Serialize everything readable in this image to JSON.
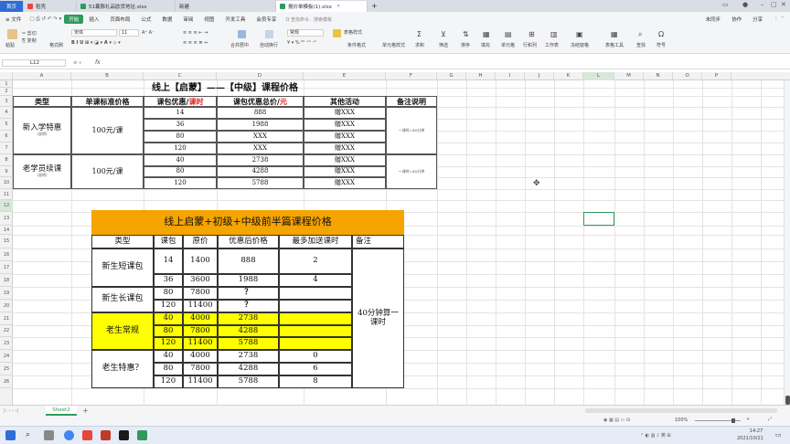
{
  "tabs": [
    {
      "label": "首页",
      "type": "home"
    },
    {
      "label": "稻壳",
      "icon_color": "#e8453c"
    },
    {
      "label": "51囊豚礼品欧货地址.xlsx",
      "icon_color": "#2f9a5a"
    },
    {
      "label": "新建",
      "icon_color": ""
    },
    {
      "label": "报价单模板(1).xlsx",
      "icon_color": "#2f9a5a",
      "active": true
    }
  ],
  "menu": {
    "file": "≡ 文件",
    "items": [
      "开始",
      "插入",
      "页面布局",
      "公式",
      "数据",
      "审阅",
      "视图",
      "开发工具",
      "会员专享"
    ],
    "search": "Q 查找命令、搜索模板",
    "right": [
      "未同步",
      "协作",
      "分享"
    ]
  },
  "ribbon": {
    "paste": "粘贴",
    "cut": "✂ 剪切",
    "copy": "⎘ 复制",
    "format_painter": "格式刷",
    "font": "宋体",
    "font_size": "11",
    "merge": "合并居中",
    "wrap": "自动换行",
    "number_format": "常规",
    "table_style": "表格样式",
    "cell_style": "单元格样式",
    "sum": "求和",
    "filter": "筛选",
    "sort": "排序",
    "fill": "填充",
    "cell": "单元格",
    "rowcol": "行和列",
    "sheet": "工作表",
    "freeze": "冻结窗格",
    "tools": "表格工具",
    "find": "查找",
    "symbol": "符号",
    "cond_format": "条件格式"
  },
  "formula_bar": {
    "cell_ref": "L12",
    "fx": "fx",
    "value": ""
  },
  "columns": [
    "A",
    "B",
    "C",
    "D",
    "E",
    "F",
    "G",
    "H",
    "I",
    "J",
    "K",
    "L",
    "M",
    "N",
    "O",
    "P"
  ],
  "rows": [
    "1",
    "2",
    "3",
    "4",
    "5",
    "6",
    "7",
    "8",
    "9",
    "10",
    "11",
    "12",
    "13",
    "14",
    "15",
    "16",
    "17",
    "18",
    "19",
    "20",
    "21",
    "22",
    "23",
    "24",
    "25",
    "26"
  ],
  "table1": {
    "title": "线上【启蒙】——【中级】课程价格",
    "headers": {
      "type": "类型",
      "unit_price": "单课标准价格",
      "pkg_prefix": "课包优惠/",
      "pkg_red": "课时",
      "total_prefix": "课包优惠总价/",
      "total_red": "元",
      "activity": "其他活动",
      "remark": "备注说明"
    },
    "groups": [
      {
        "name": "新入学特惠",
        "sub": "（说明）",
        "price": "100元/课",
        "remark": "一课时=40分钟",
        "rows": [
          [
            "14",
            "888",
            "赠XXX"
          ],
          [
            "36",
            "1988",
            "赠XXX"
          ],
          [
            "80",
            "XXX",
            "赠XXX"
          ],
          [
            "120",
            "XXX",
            "赠XXX"
          ]
        ]
      },
      {
        "name": "老学员续课",
        "sub": "（说明）",
        "price": "100元/课",
        "remark": "一课时=40分钟",
        "rows": [
          [
            "40",
            "2738",
            "赠XXX"
          ],
          [
            "80",
            "4288",
            "赠XXX"
          ],
          [
            "120",
            "5788",
            "赠XXX"
          ]
        ]
      }
    ]
  },
  "table2": {
    "title": "线上启蒙+初级+中级前半篇课程价格",
    "headers": [
      "类型",
      "课包",
      "原价",
      "优惠后价格",
      "最多加送课时",
      "备注"
    ],
    "remark": "40分钟算一课时",
    "groups": [
      {
        "name": "新生短课包",
        "highlight": false,
        "rows": [
          [
            "14",
            "1400",
            "888",
            "2"
          ],
          [
            "36",
            "3600",
            "1988",
            "4"
          ]
        ]
      },
      {
        "name": "新生长课包",
        "highlight": false,
        "rows": [
          [
            "80",
            "7800",
            "？",
            ""
          ],
          [
            "120",
            "11400",
            "？",
            ""
          ]
        ]
      },
      {
        "name": "老生常规",
        "highlight": true,
        "rows": [
          [
            "40",
            "4000",
            "2738",
            ""
          ],
          [
            "80",
            "7800",
            "4288",
            ""
          ],
          [
            "120",
            "11400",
            "5788",
            ""
          ]
        ]
      },
      {
        "name": "老生特惠？",
        "highlight": false,
        "rows": [
          [
            "40",
            "4000",
            "2738",
            "0"
          ],
          [
            "80",
            "7800",
            "4288",
            "6"
          ],
          [
            "120",
            "11400",
            "5788",
            "8"
          ]
        ]
      }
    ]
  },
  "sheet_tab": "Sheet2",
  "status": {
    "zoom": "100%"
  },
  "taskbar": {
    "time": "14:27",
    "date": "2021/10/21"
  },
  "colors": {
    "wps_green": "#2f9a5a",
    "home_blue": "#2f6cd6",
    "title_orange": "#f6a400",
    "highlight_yellow": "#ffff00",
    "red_text": "#e02020"
  }
}
